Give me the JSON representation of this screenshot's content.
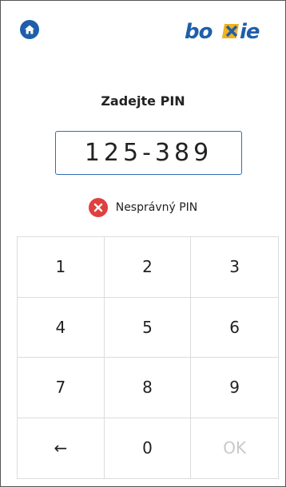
{
  "header": {
    "home_icon": "home-icon",
    "brand": {
      "logo_text": "boxie",
      "accent": "#f2b21c",
      "primary": "#1f5fa9"
    }
  },
  "title": "Zadejte PIN",
  "pin": {
    "value": "125-389",
    "border_color": "#2f6fb5"
  },
  "error": {
    "icon": "error-x-icon",
    "text": "Nesprávný PIN",
    "color": "#e0403f"
  },
  "keypad": {
    "keys": [
      {
        "label": "1",
        "enabled": true
      },
      {
        "label": "2",
        "enabled": true
      },
      {
        "label": "3",
        "enabled": true
      },
      {
        "label": "4",
        "enabled": true
      },
      {
        "label": "5",
        "enabled": true
      },
      {
        "label": "6",
        "enabled": true
      },
      {
        "label": "7",
        "enabled": true
      },
      {
        "label": "8",
        "enabled": true
      },
      {
        "label": "9",
        "enabled": true
      },
      {
        "label": "←",
        "enabled": true
      },
      {
        "label": "0",
        "enabled": true
      },
      {
        "label": "OK",
        "enabled": false
      }
    ]
  }
}
